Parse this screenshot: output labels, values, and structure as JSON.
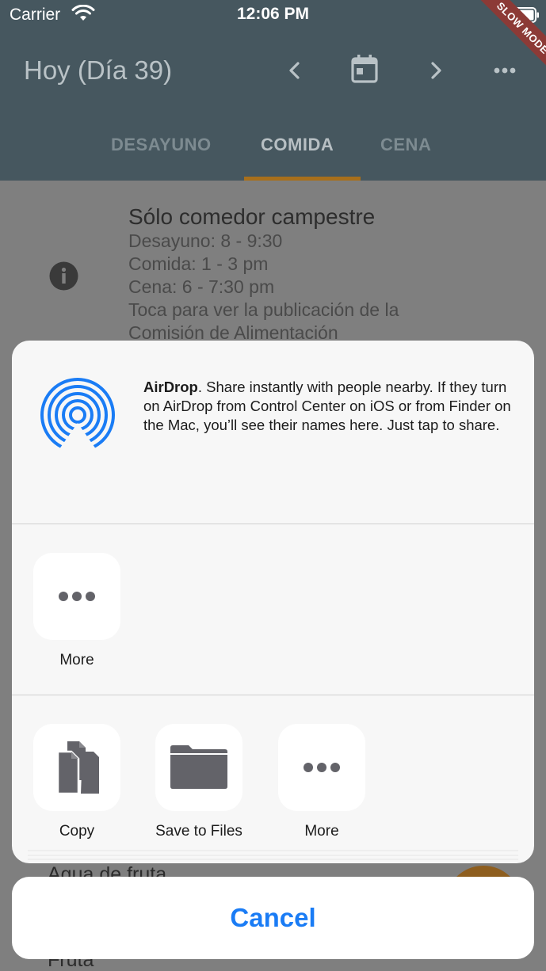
{
  "status_bar": {
    "carrier": "Carrier",
    "time": "12:06 PM"
  },
  "debug_banner": {
    "label": "SLOW MODE"
  },
  "app_bar": {
    "title": "Hoy (Día 39)"
  },
  "tabs": [
    {
      "label": "DESAYUNO",
      "selected": false
    },
    {
      "label": "COMIDA",
      "selected": true
    },
    {
      "label": "CENA",
      "selected": false
    }
  ],
  "info_card": {
    "title": "Sólo comedor campestre",
    "lines": [
      "Desayuno: 8 - 9:30",
      "Comida: 1 - 3 pm",
      "Cena: 6 - 7:30 pm",
      "Toca para ver la publicación de la",
      "Comisión de Alimentación"
    ]
  },
  "menu_items_partial": [
    "Agua de fruta",
    "Fruta"
  ],
  "share_sheet": {
    "airdrop": {
      "title": "AirDrop",
      "description": ". Share instantly with people nearby. If they turn on AirDrop from Control Center on iOS or from Finder on the Mac, you’ll see their names here. Just tap to share."
    },
    "apps_row": [
      {
        "label": "More",
        "icon": "ellipsis-icon"
      }
    ],
    "actions_row": [
      {
        "label": "Copy",
        "icon": "copy-icon"
      },
      {
        "label": "Save to Files",
        "icon": "folder-icon"
      },
      {
        "label": "More",
        "icon": "ellipsis-icon"
      }
    ],
    "cancel_label": "Cancel"
  },
  "colors": {
    "app_bar": "#46575f",
    "tab_indicator": "#a86f1b",
    "ios_blue": "#1a7cf5",
    "sheet_bg": "#f7f7f7",
    "icon_gray": "#636369"
  }
}
